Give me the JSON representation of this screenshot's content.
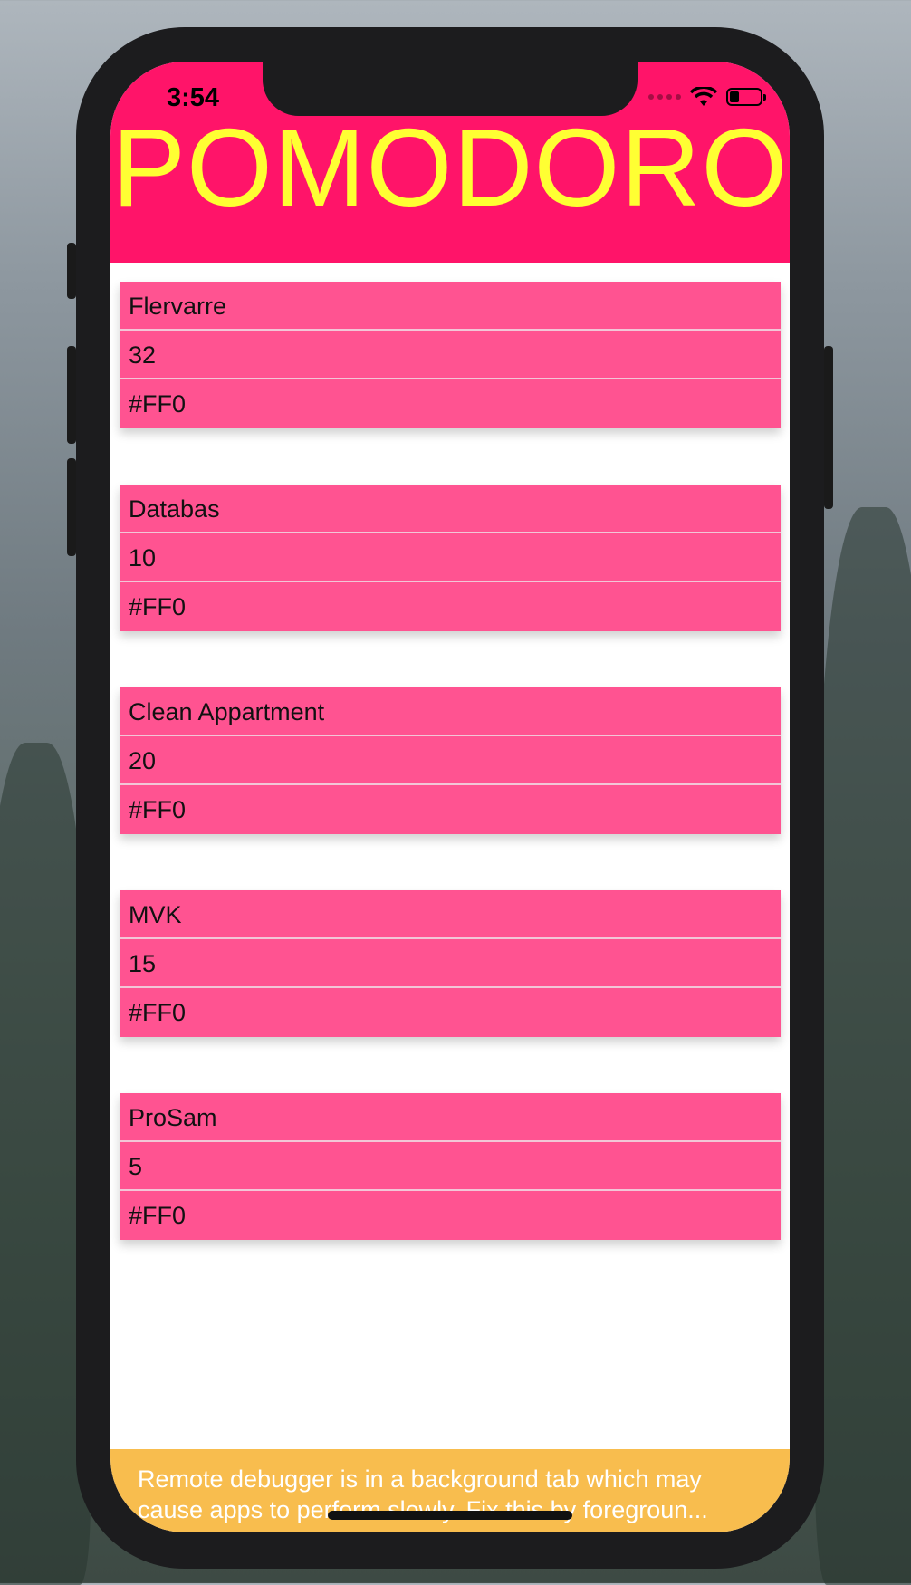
{
  "status_bar": {
    "time": "3:54"
  },
  "header": {
    "title": "POMODORO"
  },
  "tasks": [
    {
      "name": "Flervarre",
      "minutes": "32",
      "color": "#FF0"
    },
    {
      "name": "Databas",
      "minutes": "10",
      "color": "#FF0"
    },
    {
      "name": "Clean Appartment",
      "minutes": "20",
      "color": "#FF0"
    },
    {
      "name": "MVK",
      "minutes": "15",
      "color": "#FF0"
    },
    {
      "name": "ProSam",
      "minutes": "5",
      "color": "#FF0"
    }
  ],
  "debug_banner": {
    "line1": "Remote debugger is in a background tab which may",
    "line2": "cause apps to perform slowly. Fix this by foregroun..."
  },
  "colors": {
    "header_bg": "#ff1469",
    "title_text": "#ffff33",
    "card_bg": "#ff5391",
    "banner_bg": "#f8bd4e"
  }
}
